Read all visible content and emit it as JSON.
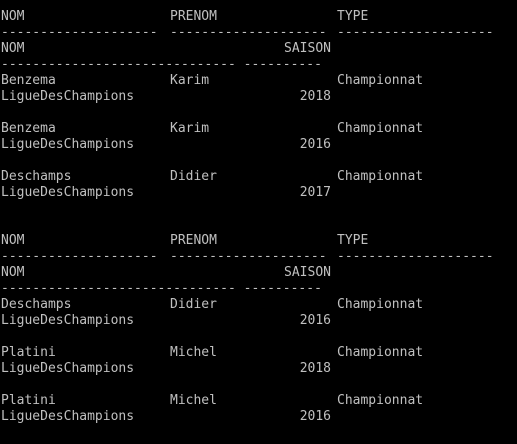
{
  "console": {
    "text_color": "#c0c0c0",
    "background": "#000000",
    "blocks": [
      {
        "header1": {
          "nom": "NOM",
          "prenom": "PRENOM",
          "type": "TYPE"
        },
        "sep1": {
          "a": "--------------------",
          "b": "--------------------",
          "c": "--------------------"
        },
        "header2": {
          "nom": "NOM",
          "saison": "SAISON"
        },
        "sep2": {
          "a": "------------------------------ ----------"
        },
        "rows": [
          {
            "nom": "Benzema",
            "prenom": "Karim",
            "type": "Championnat",
            "competition": "LigueDesChampions",
            "saison": "2018"
          },
          {
            "nom": "Benzema",
            "prenom": "Karim",
            "type": "Championnat",
            "competition": "LigueDesChampions",
            "saison": "2016"
          },
          {
            "nom": "Deschamps",
            "prenom": "Didier",
            "type": "Championnat",
            "competition": "LigueDesChampions",
            "saison": "2017"
          }
        ]
      },
      {
        "header1": {
          "nom": "NOM",
          "prenom": "PRENOM",
          "type": "TYPE"
        },
        "sep1": {
          "a": "--------------------",
          "b": "--------------------",
          "c": "--------------------"
        },
        "header2": {
          "nom": "NOM",
          "saison": "SAISON"
        },
        "sep2": {
          "a": "------------------------------ ----------"
        },
        "rows": [
          {
            "nom": "Deschamps",
            "prenom": "Didier",
            "type": "Championnat",
            "competition": "LigueDesChampions",
            "saison": "2016"
          },
          {
            "nom": "Platini",
            "prenom": "Michel",
            "type": "Championnat",
            "competition": "LigueDesChampions",
            "saison": "2018"
          },
          {
            "nom": "Platini",
            "prenom": "Michel",
            "type": "Championnat",
            "competition": "LigueDesChampions",
            "saison": "2016"
          }
        ]
      }
    ]
  }
}
